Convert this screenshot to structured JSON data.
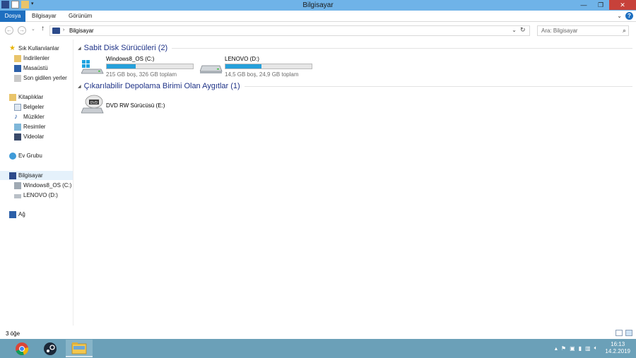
{
  "window": {
    "title": "Bilgisayar",
    "buttons": {
      "minimize": "—",
      "maximize": "❐",
      "close": "✕"
    }
  },
  "ribbon": {
    "tabs": [
      {
        "label": "Dosya"
      },
      {
        "label": "Bilgisayar"
      },
      {
        "label": "Görünüm"
      }
    ],
    "help": "?"
  },
  "address": {
    "path": "Bilgisayar",
    "search_placeholder": "Ara: Bilgisayar"
  },
  "sidebar": {
    "favorites": {
      "label": "Sık Kullanılanlar",
      "items": [
        {
          "label": "İndirilenler"
        },
        {
          "label": "Masaüstü"
        },
        {
          "label": "Son gidilen yerler"
        }
      ]
    },
    "libraries": {
      "label": "Kitaplıklar",
      "items": [
        {
          "label": "Belgeler"
        },
        {
          "label": "Müzikler"
        },
        {
          "label": "Resimler"
        },
        {
          "label": "Videolar"
        }
      ]
    },
    "homegroup": {
      "label": "Ev Grubu"
    },
    "computer": {
      "label": "Bilgisayar",
      "items": [
        {
          "label": "Windows8_OS (C:)"
        },
        {
          "label": "LENOVO (D:)"
        }
      ]
    },
    "network": {
      "label": "Ağ"
    }
  },
  "main": {
    "hard_drives_group": "Sabit Disk Sürücüleri (2)",
    "removable_group": "Çıkarılabilir Depolama Birimi Olan Aygıtlar (1)",
    "drives": [
      {
        "name": "Windows8_OS (C:)",
        "free": "215 GB boş, 326 GB toplam",
        "used_fraction": 0.34
      },
      {
        "name": "LENOVO (D:)",
        "free": "14,5 GB boş, 24,9 GB toplam",
        "used_fraction": 0.42
      }
    ],
    "dvd": {
      "name": "DVD RW Sürücüsü (E:)",
      "badge": "DVD"
    }
  },
  "status": {
    "count": "3 öğe"
  },
  "taskbar": {
    "apps": [
      "chrome-icon",
      "steam-icon",
      "file-explorer-icon"
    ],
    "time": "16:13",
    "date": "14.2.2019"
  },
  "colors": {
    "accent": "#1e6fc0",
    "title_bar": "#6fb3e8",
    "taskbar": "#6ba0b8",
    "drive_fill": "#26a0da",
    "group_text": "#1e3287",
    "close": "#c7413a"
  }
}
